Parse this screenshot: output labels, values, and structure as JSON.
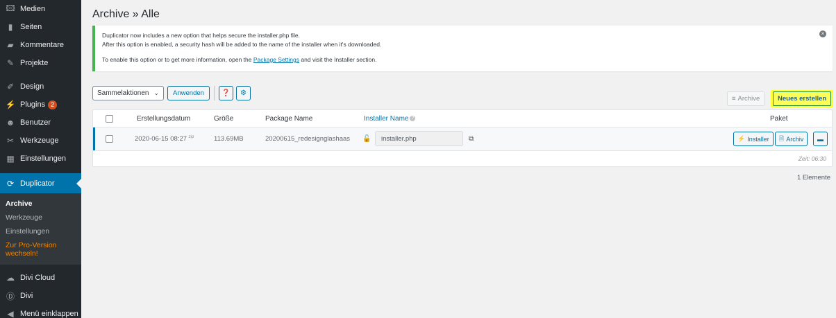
{
  "sidebar": {
    "items_top": [
      {
        "icon": "media-icon",
        "glyph": "🖾",
        "label": "Medien"
      },
      {
        "icon": "pages-icon",
        "glyph": "▮",
        "label": "Seiten"
      },
      {
        "icon": "comments-icon",
        "glyph": "▰",
        "label": "Kommentare"
      },
      {
        "icon": "pin-icon",
        "glyph": "✎",
        "label": "Projekte"
      }
    ],
    "items_mid": [
      {
        "icon": "brush-icon",
        "glyph": "✐",
        "label": "Design"
      },
      {
        "icon": "plugins-icon",
        "glyph": "⚡",
        "label": "Plugins",
        "badge": "2"
      },
      {
        "icon": "users-icon",
        "glyph": "☻",
        "label": "Benutzer"
      },
      {
        "icon": "tools-icon",
        "glyph": "✂",
        "label": "Werkzeuge"
      },
      {
        "icon": "settings-icon",
        "glyph": "▦",
        "label": "Einstellungen"
      }
    ],
    "current": {
      "icon": "duplicator-icon",
      "glyph": "⟳",
      "label": "Duplicator"
    },
    "submenu": [
      "Archive",
      "Werkzeuge",
      "Einstellungen",
      "Zur Pro-Version wechseln!"
    ],
    "items_bottom": [
      {
        "icon": "cloud-icon",
        "glyph": "☁",
        "label": "Divi Cloud"
      },
      {
        "icon": "divi-icon",
        "glyph": "Ⓓ",
        "label": "Divi"
      },
      {
        "icon": "collapse-icon",
        "glyph": "◀",
        "label": "Menü einklappen"
      }
    ]
  },
  "page": {
    "title": "Archive » Alle"
  },
  "notice": {
    "line1": "Duplicator now includes a new option that helps secure the installer.php file.",
    "line2": "After this option is enabled, a security hash will be added to the name of the installer when it's downloaded.",
    "line3_pre": "To enable this option or to get more information, open the ",
    "line3_link": "Package Settings",
    "line3_post": " and visit the Installer section."
  },
  "toolbar": {
    "bulk_select": "Sammelaktionen",
    "apply": "Anwenden",
    "archive_btn": "Archive",
    "new_btn": "Neues erstellen"
  },
  "table": {
    "headers": {
      "date": "Erstellungsdatum",
      "size": "Größe",
      "name": "Package Name",
      "installer": "Installer Name",
      "package": "Paket"
    },
    "row": {
      "date": "2020-06-15 08:27",
      "date_sup": "zip",
      "size": "113.69MB",
      "name": "20200615_redesignglashaas",
      "installer_value": "installer.php",
      "btn_installer": "Installer",
      "btn_archive": "Archiv"
    },
    "footer_time": "Zeit: 06:30"
  },
  "count": "1 Elemente"
}
